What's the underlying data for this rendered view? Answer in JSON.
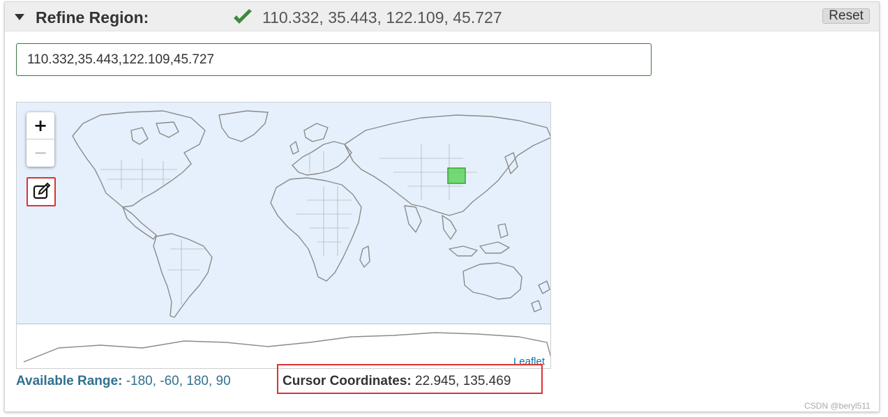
{
  "header": {
    "title": "Refine Region:",
    "value": "110.332, 35.443, 122.109, 45.727",
    "reset_label": "Reset",
    "status_icon": "checkmark-icon",
    "status_color": "#3c8a3c"
  },
  "region_input": {
    "value": "110.332,35.443,122.109,45.727"
  },
  "map": {
    "zoom_in": "+",
    "zoom_out": "−",
    "draw_icon": "edit-rectangle-icon",
    "attribution": "Leaflet",
    "selection_color": "#33cc33"
  },
  "footer": {
    "available_label": "Available Range:",
    "available_value": "-180, -60, 180, 90",
    "cursor_label": "Cursor Coordinates:",
    "cursor_value": "22.945, 135.469"
  },
  "watermark": "CSDN @beryl511"
}
